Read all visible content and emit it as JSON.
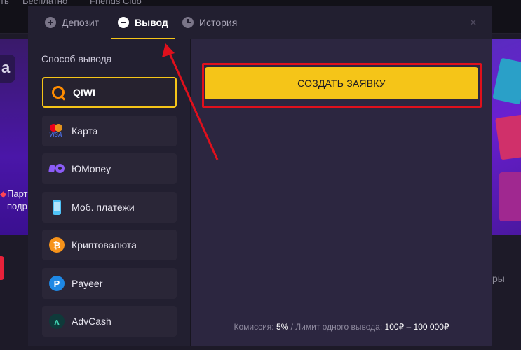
{
  "background": {
    "topbar_items": [
      "ть",
      "Бесплатно",
      "Friends Club"
    ],
    "promo_tile_letter": "а",
    "promo_text_line1": "Парт",
    "promo_text_line2": "подр",
    "right_partial_text": "ры"
  },
  "tabs": [
    {
      "label": "Депозит",
      "icon": "plus-circle-icon"
    },
    {
      "label": "Вывод",
      "icon": "minus-circle-icon",
      "active": true
    },
    {
      "label": "История",
      "icon": "clock-icon"
    }
  ],
  "close_label": "×",
  "withdraw": {
    "section_label": "Способ вывода",
    "methods": [
      {
        "label": "QIWI",
        "icon": "qiwi-icon",
        "selected": true
      },
      {
        "label": "Карта",
        "icon": "card-icon"
      },
      {
        "label": "ЮMoney",
        "icon": "yoomoney-icon"
      },
      {
        "label": "Моб. платежи",
        "icon": "phone-icon"
      },
      {
        "label": "Криптовалюта",
        "icon": "bitcoin-icon",
        "glyph": "₿"
      },
      {
        "label": "Payeer",
        "icon": "payeer-icon",
        "glyph": "P"
      },
      {
        "label": "AdvCash",
        "icon": "advcash-icon",
        "glyph": "ʌ"
      }
    ],
    "card_brand": "VISA",
    "create_button": "СОЗДАТЬ ЗАЯВКУ",
    "footer": {
      "commission_label": "Комиссия:",
      "commission_value": "5%",
      "limit_label": "/ Лимит одного вывода:",
      "limit_value": "100₽ – 100 000₽"
    }
  },
  "colors": {
    "accent": "#f5c518",
    "annotation_red": "#e0101c",
    "modal_bg": "#2c2640",
    "sidebar_bg": "#221f30"
  }
}
